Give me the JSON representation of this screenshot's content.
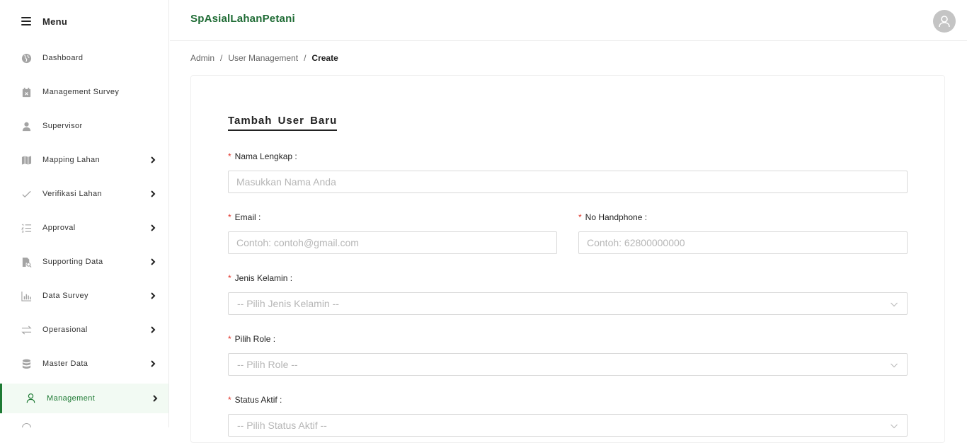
{
  "sidebar": {
    "menu_label": "Menu",
    "items": [
      {
        "label": "Dashboard",
        "icon": "globe-icon"
      },
      {
        "label": "Management Survey",
        "icon": "calendar-icon"
      },
      {
        "label": "Supervisor",
        "icon": "person-icon"
      },
      {
        "label": "Mapping Lahan",
        "icon": "map-icon"
      },
      {
        "label": "Verifikasi Lahan",
        "icon": "check-icon"
      },
      {
        "label": "Approval",
        "icon": "ordered-list-icon"
      },
      {
        "label": "Supporting Data",
        "icon": "file-search-icon"
      },
      {
        "label": "Data Survey",
        "icon": "bar-chart-icon"
      },
      {
        "label": "Operasional",
        "icon": "swap-icon"
      },
      {
        "label": "Master Data",
        "icon": "database-icon"
      },
      {
        "label": "Management",
        "icon": "user-icon"
      }
    ],
    "active_item": "Management"
  },
  "header": {
    "brand": "SpAsialLahanPetani",
    "avatar_icon": "user-avatar-icon"
  },
  "breadcrumb": {
    "items": [
      "Admin",
      "User Management",
      "Create"
    ],
    "separator": "/"
  },
  "form": {
    "title": "Tambah User Baru",
    "required_mark": "*",
    "fields": {
      "nama": {
        "label": "Nama Lengkap :",
        "placeholder": "Masukkan Nama Anda"
      },
      "email": {
        "label": "Email :",
        "placeholder": "Contoh: contoh@gmail.com"
      },
      "phone": {
        "label": "No Handphone :",
        "placeholder": "Contoh: 62800000000"
      },
      "gender": {
        "label": "Jenis Kelamin :",
        "placeholder": "-- Pilih Jenis Kelamin --"
      },
      "role": {
        "label": "Pilih Role :",
        "placeholder": "-- Pilih Role --"
      },
      "status": {
        "label": "Status Aktif :",
        "placeholder": "-- Pilih Status Aktif --"
      }
    }
  },
  "colors": {
    "brand_green": "#1e6b34",
    "active_bg": "#f2faf3",
    "required_red": "#e0342a"
  }
}
